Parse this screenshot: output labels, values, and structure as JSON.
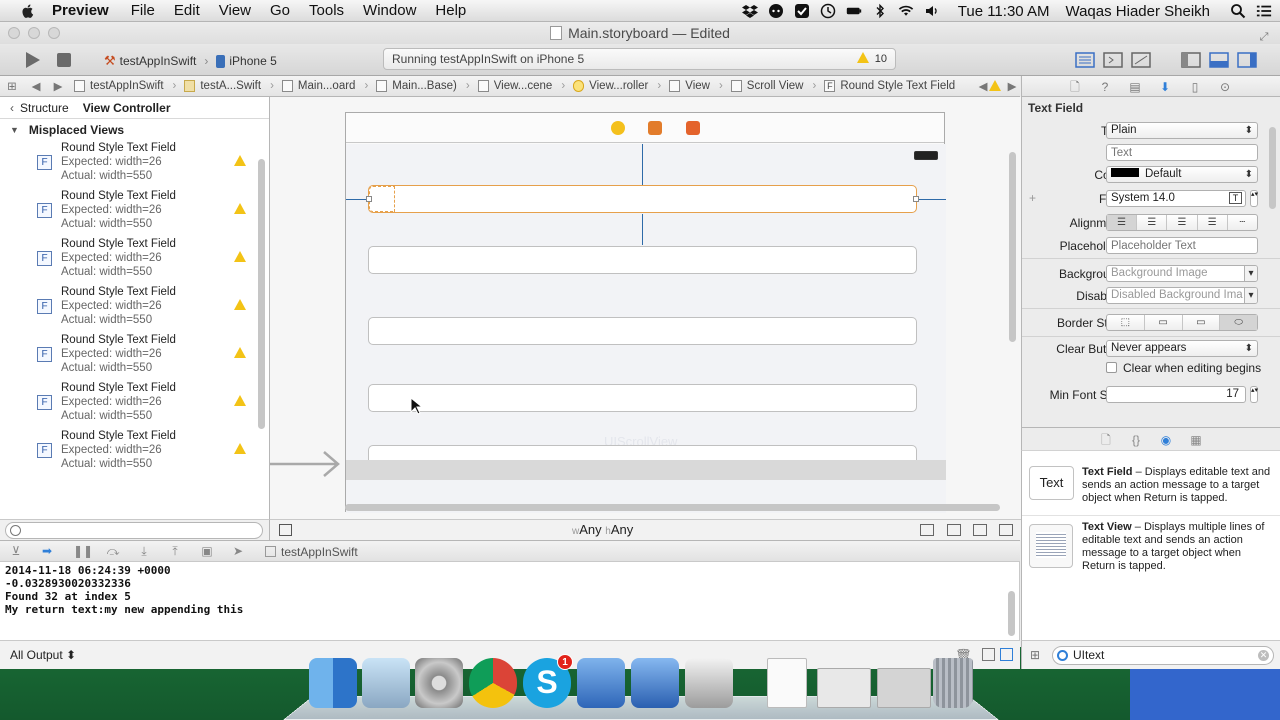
{
  "menubar": {
    "app_name": "Preview",
    "items": [
      "File",
      "Edit",
      "View",
      "Go",
      "Tools",
      "Window",
      "Help"
    ],
    "time": "Tue 11:30 AM",
    "user": "Waqas Hiader Sheikh"
  },
  "window": {
    "title": "Main.storyboard — Edited"
  },
  "toolbar": {
    "scheme_target": "testAppInSwift",
    "device": "iPhone 5",
    "activity_text": "Running testAppInSwift on iPhone 5",
    "warning_count": "10"
  },
  "jumpbar": {
    "crumbs": [
      "testAppInSwift",
      "testA...Swift",
      "Main...oard",
      "Main...Base)",
      "View...cene",
      "View...roller",
      "View",
      "Scroll View",
      "Round Style Text Field"
    ]
  },
  "outline": {
    "back_label": "Structure",
    "current_label": "View Controller",
    "group_title": "Misplaced Views",
    "issues": [
      {
        "name": "Round Style Text Field",
        "expected": "Expected: width=26",
        "actual": "Actual: width=550"
      },
      {
        "name": "Round Style Text Field",
        "expected": "Expected: width=26",
        "actual": "Actual: width=550"
      },
      {
        "name": "Round Style Text Field",
        "expected": "Expected: width=26",
        "actual": "Actual: width=550"
      },
      {
        "name": "Round Style Text Field",
        "expected": "Expected: width=26",
        "actual": "Actual: width=550"
      },
      {
        "name": "Round Style Text Field",
        "expected": "Expected: width=26",
        "actual": "Actual: width=550"
      },
      {
        "name": "Round Style Text Field",
        "expected": "Expected: width=26",
        "actual": "Actual: width=550"
      },
      {
        "name": "Round Style Text Field",
        "expected": "Expected: width=26",
        "actual": "Actual: width=550"
      }
    ]
  },
  "canvas": {
    "size_class_w_prefix": "w",
    "size_class_w": "Any",
    "size_class_h_prefix": "h",
    "size_class_h": "Any",
    "ghost_label": "UIScrollView"
  },
  "debug": {
    "target": "testAppInSwift",
    "console_lines": [
      "2014-11-18 06:24:39 +0000",
      "-0.0328930020332336",
      "Found 32 at index 5",
      "My return text:my new appending this"
    ],
    "output_filter": "All Output ⬍"
  },
  "inspector": {
    "section_title": "Text Field",
    "text_label": "Text",
    "text_value": "Plain",
    "text_placeholder": "Text",
    "color_label": "Color",
    "color_value": "Default",
    "font_label": "Font",
    "font_value": "System 14.0",
    "alignment_label": "Alignment",
    "placeholder_label": "Placeholder",
    "placeholder_placeholder": "Placeholder Text",
    "background_label": "Background",
    "background_placeholder": "Background Image",
    "disabled_label": "Disabled",
    "disabled_placeholder": "Disabled Background Ima",
    "border_style_label": "Border Style",
    "clear_button_label": "Clear Button",
    "clear_button_value": "Never appears",
    "clear_when_editing_label": "Clear when editing begins",
    "min_font_label": "Min Font Size",
    "min_font_value": "17"
  },
  "library": {
    "items": [
      {
        "icon_text": "Text",
        "title": "Text Field",
        "description": " – Displays editable text and sends an action message to a target object when Return is tapped."
      },
      {
        "title": "Text View",
        "description": " – Displays multiple lines of editable text and sends an action message to a target object when Return is tapped."
      }
    ],
    "search_value": "UItext"
  },
  "colors": {
    "selection_orange": "#e6a04b",
    "constraint_blue": "#2e6aa8",
    "warning_yellow": "#f3c316",
    "accent_blue": "#2f7fd8"
  }
}
